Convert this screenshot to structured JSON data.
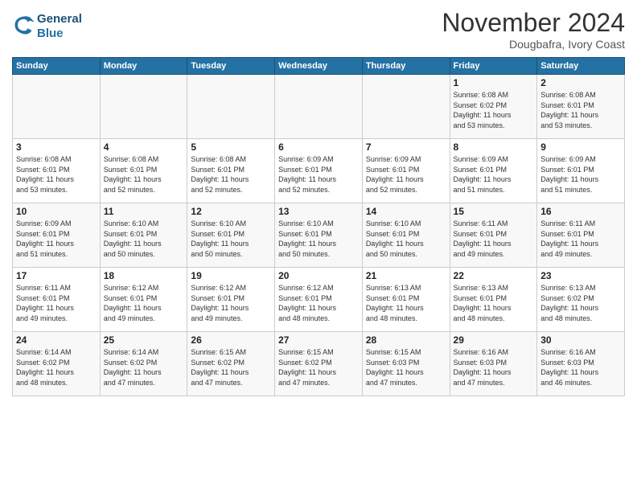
{
  "header": {
    "logo_line1": "General",
    "logo_line2": "Blue",
    "month_title": "November 2024",
    "location": "Dougbafra, Ivory Coast"
  },
  "days_of_week": [
    "Sunday",
    "Monday",
    "Tuesday",
    "Wednesday",
    "Thursday",
    "Friday",
    "Saturday"
  ],
  "weeks": [
    [
      {
        "day": "",
        "info": ""
      },
      {
        "day": "",
        "info": ""
      },
      {
        "day": "",
        "info": ""
      },
      {
        "day": "",
        "info": ""
      },
      {
        "day": "",
        "info": ""
      },
      {
        "day": "1",
        "info": "Sunrise: 6:08 AM\nSunset: 6:02 PM\nDaylight: 11 hours\nand 53 minutes."
      },
      {
        "day": "2",
        "info": "Sunrise: 6:08 AM\nSunset: 6:01 PM\nDaylight: 11 hours\nand 53 minutes."
      }
    ],
    [
      {
        "day": "3",
        "info": "Sunrise: 6:08 AM\nSunset: 6:01 PM\nDaylight: 11 hours\nand 53 minutes."
      },
      {
        "day": "4",
        "info": "Sunrise: 6:08 AM\nSunset: 6:01 PM\nDaylight: 11 hours\nand 52 minutes."
      },
      {
        "day": "5",
        "info": "Sunrise: 6:08 AM\nSunset: 6:01 PM\nDaylight: 11 hours\nand 52 minutes."
      },
      {
        "day": "6",
        "info": "Sunrise: 6:09 AM\nSunset: 6:01 PM\nDaylight: 11 hours\nand 52 minutes."
      },
      {
        "day": "7",
        "info": "Sunrise: 6:09 AM\nSunset: 6:01 PM\nDaylight: 11 hours\nand 52 minutes."
      },
      {
        "day": "8",
        "info": "Sunrise: 6:09 AM\nSunset: 6:01 PM\nDaylight: 11 hours\nand 51 minutes."
      },
      {
        "day": "9",
        "info": "Sunrise: 6:09 AM\nSunset: 6:01 PM\nDaylight: 11 hours\nand 51 minutes."
      }
    ],
    [
      {
        "day": "10",
        "info": "Sunrise: 6:09 AM\nSunset: 6:01 PM\nDaylight: 11 hours\nand 51 minutes."
      },
      {
        "day": "11",
        "info": "Sunrise: 6:10 AM\nSunset: 6:01 PM\nDaylight: 11 hours\nand 50 minutes."
      },
      {
        "day": "12",
        "info": "Sunrise: 6:10 AM\nSunset: 6:01 PM\nDaylight: 11 hours\nand 50 minutes."
      },
      {
        "day": "13",
        "info": "Sunrise: 6:10 AM\nSunset: 6:01 PM\nDaylight: 11 hours\nand 50 minutes."
      },
      {
        "day": "14",
        "info": "Sunrise: 6:10 AM\nSunset: 6:01 PM\nDaylight: 11 hours\nand 50 minutes."
      },
      {
        "day": "15",
        "info": "Sunrise: 6:11 AM\nSunset: 6:01 PM\nDaylight: 11 hours\nand 49 minutes."
      },
      {
        "day": "16",
        "info": "Sunrise: 6:11 AM\nSunset: 6:01 PM\nDaylight: 11 hours\nand 49 minutes."
      }
    ],
    [
      {
        "day": "17",
        "info": "Sunrise: 6:11 AM\nSunset: 6:01 PM\nDaylight: 11 hours\nand 49 minutes."
      },
      {
        "day": "18",
        "info": "Sunrise: 6:12 AM\nSunset: 6:01 PM\nDaylight: 11 hours\nand 49 minutes."
      },
      {
        "day": "19",
        "info": "Sunrise: 6:12 AM\nSunset: 6:01 PM\nDaylight: 11 hours\nand 49 minutes."
      },
      {
        "day": "20",
        "info": "Sunrise: 6:12 AM\nSunset: 6:01 PM\nDaylight: 11 hours\nand 48 minutes."
      },
      {
        "day": "21",
        "info": "Sunrise: 6:13 AM\nSunset: 6:01 PM\nDaylight: 11 hours\nand 48 minutes."
      },
      {
        "day": "22",
        "info": "Sunrise: 6:13 AM\nSunset: 6:01 PM\nDaylight: 11 hours\nand 48 minutes."
      },
      {
        "day": "23",
        "info": "Sunrise: 6:13 AM\nSunset: 6:02 PM\nDaylight: 11 hours\nand 48 minutes."
      }
    ],
    [
      {
        "day": "24",
        "info": "Sunrise: 6:14 AM\nSunset: 6:02 PM\nDaylight: 11 hours\nand 48 minutes."
      },
      {
        "day": "25",
        "info": "Sunrise: 6:14 AM\nSunset: 6:02 PM\nDaylight: 11 hours\nand 47 minutes."
      },
      {
        "day": "26",
        "info": "Sunrise: 6:15 AM\nSunset: 6:02 PM\nDaylight: 11 hours\nand 47 minutes."
      },
      {
        "day": "27",
        "info": "Sunrise: 6:15 AM\nSunset: 6:02 PM\nDaylight: 11 hours\nand 47 minutes."
      },
      {
        "day": "28",
        "info": "Sunrise: 6:15 AM\nSunset: 6:03 PM\nDaylight: 11 hours\nand 47 minutes."
      },
      {
        "day": "29",
        "info": "Sunrise: 6:16 AM\nSunset: 6:03 PM\nDaylight: 11 hours\nand 47 minutes."
      },
      {
        "day": "30",
        "info": "Sunrise: 6:16 AM\nSunset: 6:03 PM\nDaylight: 11 hours\nand 46 minutes."
      }
    ]
  ]
}
